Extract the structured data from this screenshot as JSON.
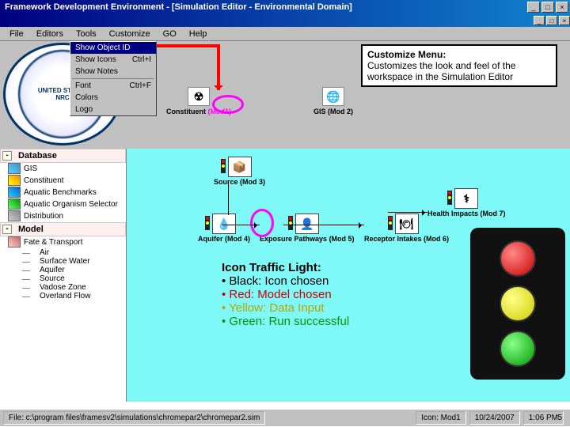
{
  "titlebar": {
    "title": "Framework Development Environment - [Simulation Editor - Environmental Domain]"
  },
  "menubar": {
    "items": [
      "File",
      "Editors",
      "Tools",
      "Customize",
      "GO",
      "Help"
    ]
  },
  "dropdown": {
    "items": [
      {
        "label": "Show Object ID",
        "checked": true,
        "sel": true
      },
      {
        "label": "Show Icons",
        "shortcut": "Ctrl+I"
      },
      {
        "label": "Show Notes"
      },
      {
        "label": "Font",
        "shortcut": "Ctrl+F"
      },
      {
        "label": "Colors"
      },
      {
        "label": "Logo"
      }
    ]
  },
  "workspace_icons": {
    "constituent": {
      "label": "Constituent",
      "tag": "(Mod1)"
    },
    "gis": {
      "label": "GIS",
      "tag": "(Mod 2)"
    }
  },
  "annotations": {
    "customize": {
      "title": "Customize Menu:",
      "body": "Customizes the look and feel of the workspace in the Simulation Editor"
    },
    "traffic": {
      "title": "Icon Traffic Light:",
      "b1": "• Black:  Icon chosen",
      "b2": "• Red: Model chosen",
      "b3": "• Yellow: Data Input",
      "b4": "• Green: Run successful"
    }
  },
  "sidebar": {
    "g1": {
      "head": "Database",
      "items": [
        "GIS",
        "Constituent",
        "Aquatic Benchmarks",
        "Aquatic Organism Selector",
        "Distribution"
      ]
    },
    "g2": {
      "head": "Model",
      "items": [
        "Fate & Transport"
      ],
      "subs": [
        "Air",
        "Surface Water",
        "Aquifer",
        "Source",
        "Vadose Zone",
        "Overland Flow"
      ]
    }
  },
  "canvas_mods": {
    "source": {
      "label": "Source",
      "tag": "(Mod 3)"
    },
    "aquifer": {
      "label": "Aquifer",
      "tag": "(Mod 4)"
    },
    "exposure": {
      "label": "Exposure Pathways",
      "tag": "(Mod 5)"
    },
    "receptor": {
      "label": "Receptor Intakes",
      "tag": "(Mod 6)"
    },
    "health": {
      "label": "Health Impacts",
      "tag": "(Mod 7)"
    }
  },
  "statusbar": {
    "path": "File: c:\\program files\\framesv2\\simulations\\chromepar2\\chromepar2.sim",
    "icon": "Icon: Mod1",
    "date": "10/24/2007",
    "time": "1:06 PM"
  },
  "page_number": "5"
}
